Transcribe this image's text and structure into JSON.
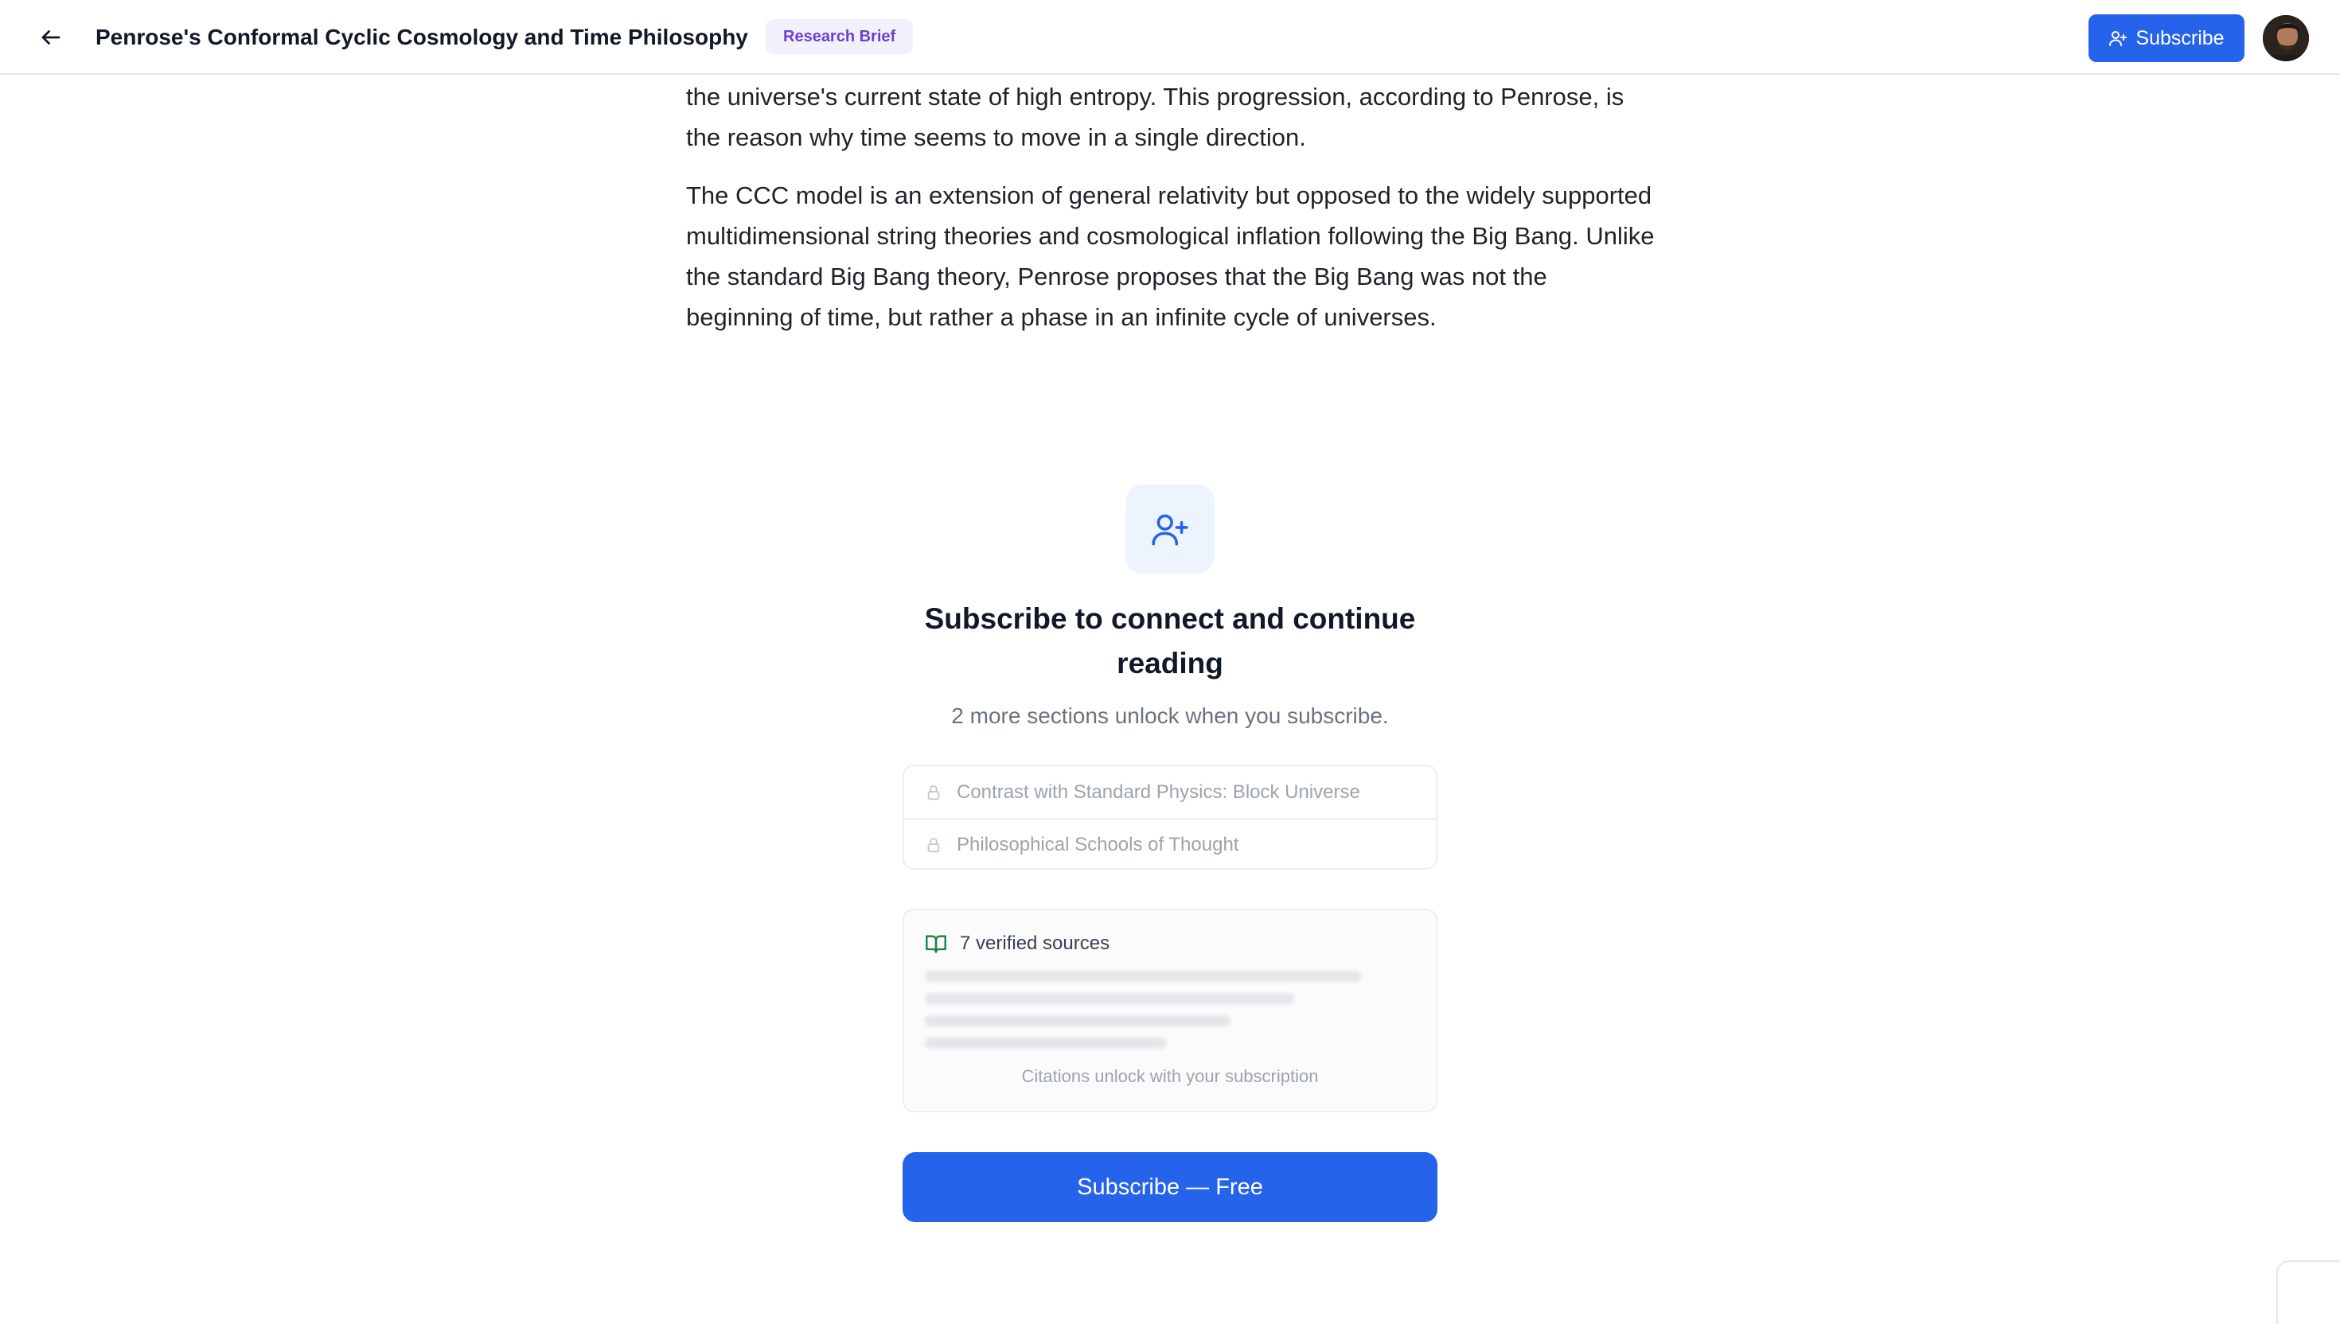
{
  "header": {
    "title": "Penrose's Conformal Cyclic Cosmology and Time Philosophy",
    "badge": "Research Brief",
    "subscribe_label": "Subscribe",
    "back_icon": "arrow-left-icon",
    "subscribe_icon": "user-plus-icon"
  },
  "article": {
    "paragraphs": [
      "the universe's current state of high entropy. This progression, according to Penrose, is the reason why time seems to move in a single direction.",
      "The CCC model is an extension of general relativity but opposed to the widely supported multidimensional string theories and cosmological inflation following the Big Bang. Unlike the standard Big Bang theory, Penrose proposes that the Big Bang was not the beginning of time, but rather a phase in an infinite cycle of universes."
    ]
  },
  "gate": {
    "icon": "user-plus-icon",
    "title": "Subscribe to connect and continue reading",
    "subtitle": "2 more sections unlock when you subscribe.",
    "locked_sections": [
      "Contrast with Standard Physics: Block Universe",
      "Philosophical Schools of Thought"
    ],
    "sources": {
      "icon": "open-book-icon",
      "label": "7 verified sources",
      "footnote": "Citations unlock with your subscription"
    },
    "cta_label": "Subscribe — Free"
  },
  "colors": {
    "accent": "#2563eb",
    "badge_bg": "#f3f0fd",
    "badge_text": "#6d3fcf",
    "sources_icon": "#15803d"
  }
}
